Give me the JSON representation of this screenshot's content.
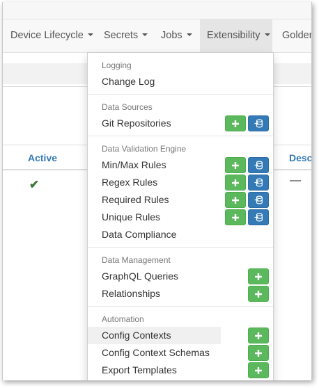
{
  "nav": {
    "items": [
      {
        "label": "Device Lifecycle",
        "caret": true
      },
      {
        "label": "Secrets",
        "caret": true
      },
      {
        "label": "Jobs",
        "caret": true
      },
      {
        "label": "Extensibility",
        "caret": true,
        "active": true
      },
      {
        "label": "Golden",
        "caret": false
      }
    ]
  },
  "table": {
    "headers": {
      "active": "Active",
      "description": "Desc"
    },
    "row": {
      "active_icon": "checkmark-icon",
      "description": "—"
    }
  },
  "dropdown": {
    "sections": [
      {
        "header": "Logging",
        "items": [
          {
            "label": "Change Log",
            "add": false,
            "import": false
          }
        ]
      },
      {
        "header": "Data Sources",
        "items": [
          {
            "label": "Git Repositories",
            "add": true,
            "import": true
          }
        ]
      },
      {
        "header": "Data Validation Engine",
        "items": [
          {
            "label": "Min/Max Rules",
            "add": true,
            "import": true
          },
          {
            "label": "Regex Rules",
            "add": true,
            "import": true
          },
          {
            "label": "Required Rules",
            "add": true,
            "import": true
          },
          {
            "label": "Unique Rules",
            "add": true,
            "import": true
          },
          {
            "label": "Data Compliance",
            "add": false,
            "import": false
          }
        ]
      },
      {
        "header": "Data Management",
        "items": [
          {
            "label": "GraphQL Queries",
            "add": true,
            "import": false
          },
          {
            "label": "Relationships",
            "add": true,
            "import": false
          }
        ]
      },
      {
        "header": "Automation",
        "items": [
          {
            "label": "Config Contexts",
            "add": true,
            "import": false,
            "hover": true
          },
          {
            "label": "Config Context Schemas",
            "add": true,
            "import": false
          },
          {
            "label": "Export Templates",
            "add": true,
            "import": false
          }
        ]
      }
    ]
  },
  "colors": {
    "link": "#337ab7",
    "add_button": "#5cb85c",
    "import_button": "#337ab7",
    "check": "#3c763d"
  }
}
